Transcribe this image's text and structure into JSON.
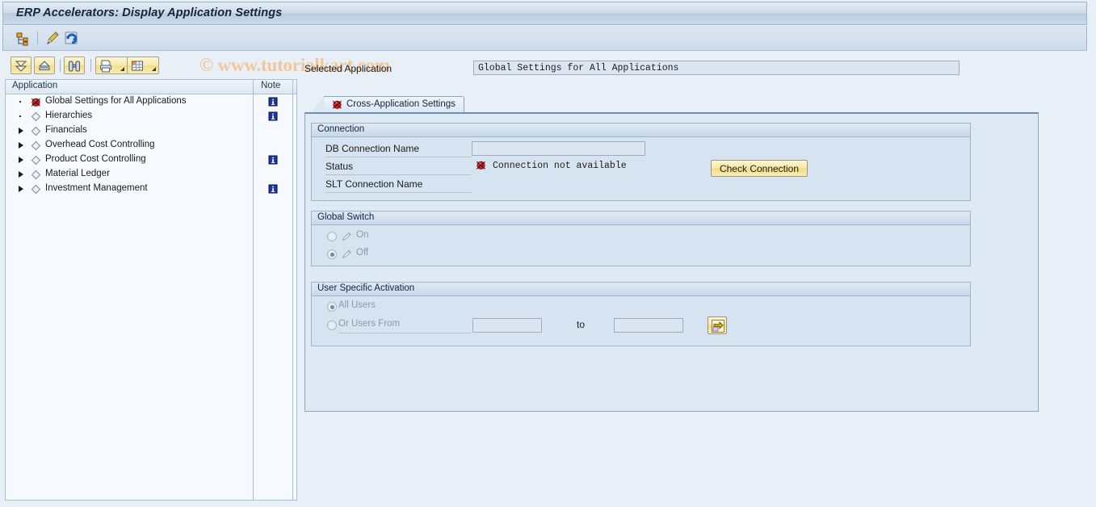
{
  "window": {
    "title": "ERP Accelerators: Display Application Settings"
  },
  "watermark": {
    "text": "© www.tutorialkart.com",
    "color": "#f0c79a"
  },
  "app_toolbar": {
    "buttons": [
      {
        "name": "tree-hierarchy-icon",
        "tooltip": "Hierarchy"
      },
      {
        "name": "edit-pencil-icon",
        "tooltip": "Change"
      },
      {
        "name": "refresh-icon",
        "tooltip": "Refresh"
      }
    ]
  },
  "tree_toolbar": {
    "buttons": [
      {
        "name": "expand-all-button",
        "icon": "expand-all-icon",
        "dropdown": false
      },
      {
        "name": "collapse-all-button",
        "icon": "collapse-all-icon",
        "dropdown": false
      },
      {
        "name": "find-button",
        "icon": "binoculars-icon",
        "dropdown": false
      },
      {
        "name": "print-button",
        "icon": "print-icon",
        "dropdown": true
      },
      {
        "name": "layout-button",
        "icon": "grid-layout-icon",
        "dropdown": true
      }
    ]
  },
  "tree": {
    "columns": [
      {
        "key": "application",
        "label": "Application"
      },
      {
        "key": "note",
        "label": "Note"
      }
    ],
    "rows": [
      {
        "label": "Global Settings for All Applications",
        "expander": "leaf",
        "node_icon": "red-ball-icon",
        "note": true,
        "selected": true
      },
      {
        "label": "Hierarchies",
        "expander": "leaf",
        "node_icon": "diamond-icon",
        "note": true,
        "selected": false
      },
      {
        "label": "Financials",
        "expander": "node",
        "node_icon": "diamond-icon",
        "note": false,
        "selected": false
      },
      {
        "label": "Overhead Cost Controlling",
        "expander": "node",
        "node_icon": "diamond-icon",
        "note": false,
        "selected": false
      },
      {
        "label": "Product Cost Controlling",
        "expander": "node",
        "node_icon": "diamond-icon",
        "note": true,
        "selected": false
      },
      {
        "label": "Material Ledger",
        "expander": "node",
        "node_icon": "diamond-icon",
        "note": false,
        "selected": false
      },
      {
        "label": "Investment Management",
        "expander": "node",
        "node_icon": "diamond-icon",
        "note": true,
        "selected": false
      }
    ]
  },
  "selected_application": {
    "label": "Selected Application",
    "value": "Global Settings for All Applications"
  },
  "tabs": [
    {
      "label": "Cross-Application Settings",
      "icon": "red-ball-icon",
      "active": true
    }
  ],
  "connection": {
    "title": "Connection",
    "db_connection_name": {
      "label": "DB Connection Name",
      "value": "",
      "placeholder": ""
    },
    "status": {
      "label": "Status",
      "icon": "red-ball-icon",
      "text": "Connection not available"
    },
    "slt_connection_name": {
      "label": "SLT Connection Name",
      "value": "",
      "placeholder": ""
    },
    "check_connection_button": "Check Connection"
  },
  "global_switch": {
    "title": "Global Switch",
    "options": [
      {
        "label": "On",
        "selected": false,
        "disabled": true,
        "icon": "pencil-disabled-icon"
      },
      {
        "label": "Off",
        "selected": true,
        "disabled": true,
        "icon": "pencil-disabled-icon"
      }
    ]
  },
  "user_specific_activation": {
    "title": "User Specific Activation",
    "options": [
      {
        "label": "All Users",
        "selected": true,
        "disabled": true
      },
      {
        "label": "Or Users From",
        "selected": false,
        "disabled": true
      }
    ],
    "from_value": "",
    "to_label": "to",
    "to_value": "",
    "multi_select_button": "multi-selection-arrow-icon"
  },
  "colors": {
    "window_bg": "#e9eff7",
    "title_bar": "#cfdceb",
    "group_bg": "#d6e3f0",
    "tab_body": "#dfe9f4",
    "input_bg": "#dde6f0",
    "button_yellow": "#f2dc84",
    "status_red": "#e01b1b",
    "note_blue": "#1a36b8"
  }
}
